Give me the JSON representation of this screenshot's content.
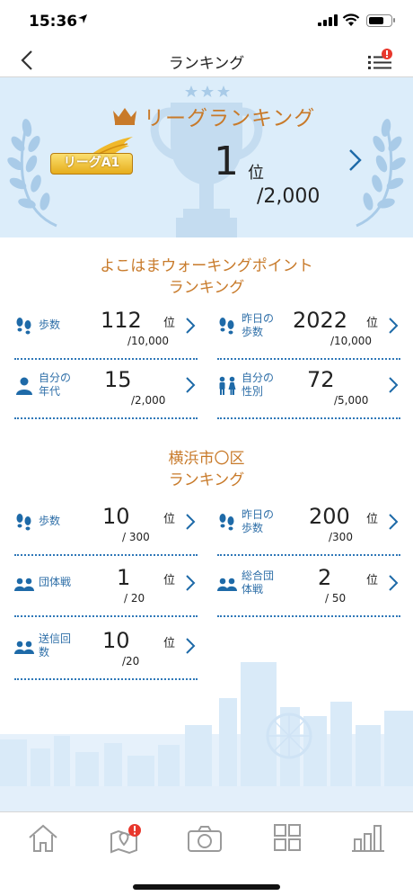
{
  "status_bar": {
    "time": "15:36"
  },
  "nav": {
    "title": "ランキング"
  },
  "league": {
    "title": "リーグランキング",
    "badge": "リーグA1",
    "rank": "1",
    "unit": "位",
    "total": "/2,000"
  },
  "sections": [
    {
      "title_line1": "よこはまウォーキングポイント",
      "title_line2": "ランキング",
      "cards": [
        {
          "icon": "footprints-icon",
          "label": "歩数",
          "value": "112",
          "unit": "位",
          "total": "/10,000"
        },
        {
          "icon": "footprints-icon",
          "label": "昨日の歩数",
          "value": "2022",
          "unit": "位",
          "total": "/10,000"
        },
        {
          "icon": "person-icon",
          "label": "自分の年代",
          "value": "15",
          "unit": "位",
          "total": "/2,000"
        },
        {
          "icon": "gender-icon",
          "label": "自分の性別",
          "value": "72",
          "unit": "位",
          "total": "/5,000"
        }
      ]
    },
    {
      "title_line1": "横浜市〇区",
      "title_line2": "ランキング",
      "cards": [
        {
          "icon": "footprints-icon",
          "label": "歩数",
          "value": "10",
          "unit": "位",
          "total": "/ 300"
        },
        {
          "icon": "footprints-icon",
          "label": "昨日の歩数",
          "value": "200",
          "unit": "位",
          "total": "/300"
        },
        {
          "icon": "group-icon",
          "label": "団体戦",
          "value": "1",
          "unit": "位",
          "total": "/ 20"
        },
        {
          "icon": "group-icon",
          "label": "総合団体戦",
          "value": "2",
          "unit": "位",
          "total": "/ 50"
        },
        {
          "icon": "group-icon",
          "label": "送信回数",
          "value": "10",
          "unit": "位",
          "total": "/20"
        }
      ]
    }
  ],
  "tabs": [
    "home-icon",
    "map-pin-icon",
    "camera-icon",
    "grid-icon",
    "bar-chart-icon"
  ],
  "colors": {
    "accent_orange": "#c87a2a",
    "accent_blue": "#2f78b8",
    "hero_bg": "#dcedfa",
    "notify_red": "#e8372c"
  }
}
